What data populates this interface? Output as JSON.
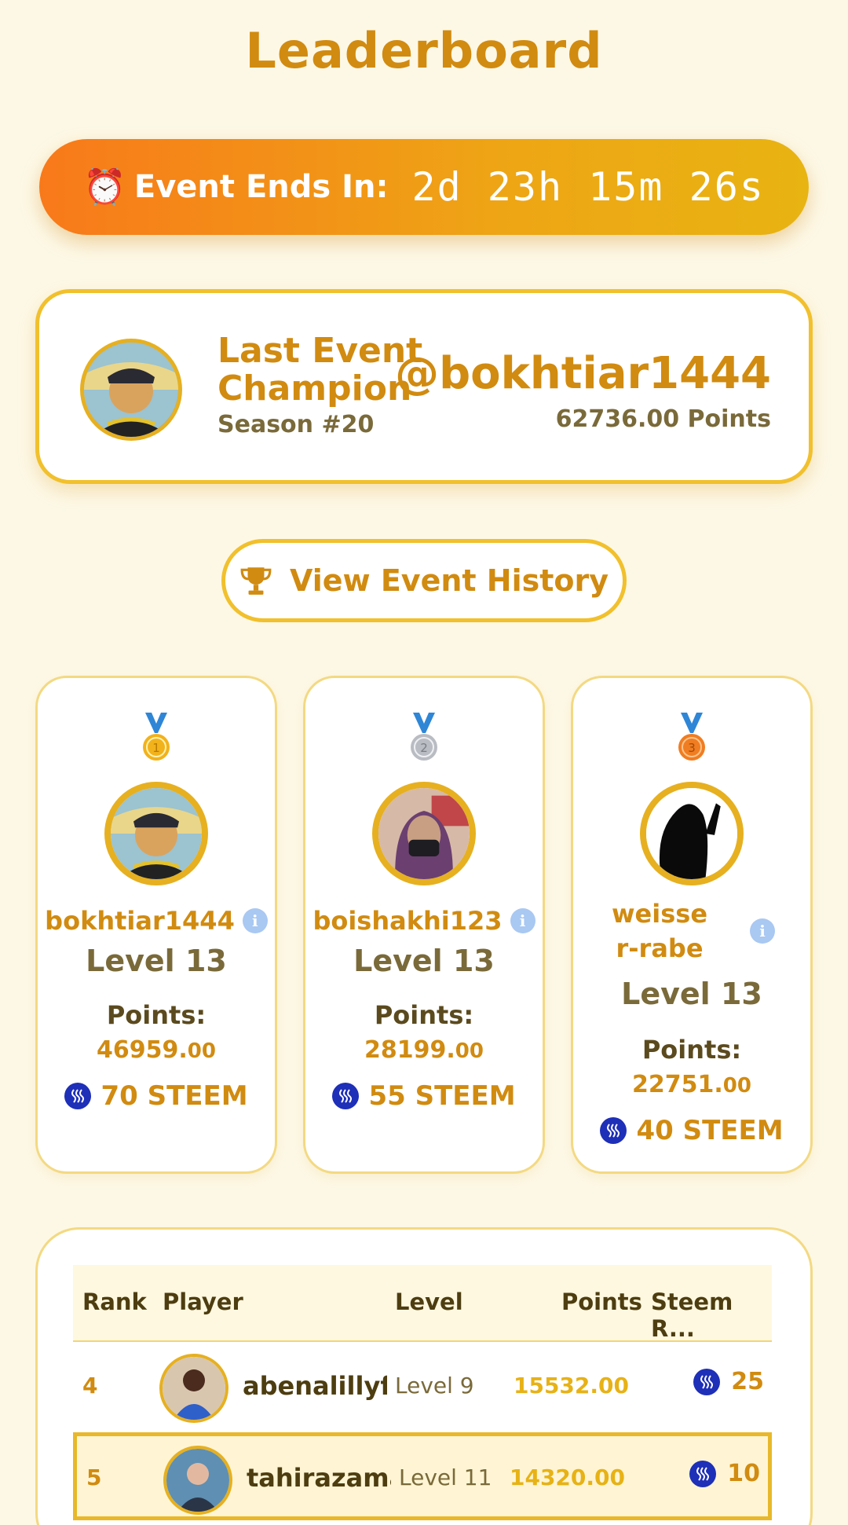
{
  "header": {
    "title": "Leaderboard"
  },
  "timer": {
    "label": "Event Ends In:",
    "value": "2d 23h 15m 26s",
    "icon": "alarm-clock-icon"
  },
  "champion": {
    "title": "Last Event Champion",
    "season": "Season #20",
    "username": "@bokhtiar1444",
    "points": "62736.00 Points"
  },
  "history_button": {
    "label": "View Event History",
    "icon": "trophy-icon"
  },
  "podium": [
    {
      "rank": "1",
      "name": "bokhtiar1444",
      "level": "Level 13",
      "points_label": "Points:",
      "points_main": "46959.",
      "points_dec": "00",
      "reward": "70 STEEM",
      "medal_color": "#f2b21b"
    },
    {
      "rank": "2",
      "name": "boishakhi123",
      "level": "Level 13",
      "points_label": "Points:",
      "points_main": "28199.",
      "points_dec": "00",
      "reward": "55 STEEM",
      "medal_color": "#b9bcc2"
    },
    {
      "rank": "3",
      "name": "weisser-rabe",
      "level": "Level 13",
      "points_label": "Points:",
      "points_main": "22751.",
      "points_dec": "00",
      "reward": "40 STEEM",
      "medal_color": "#f07d22"
    }
  ],
  "table": {
    "headers": {
      "rank": "Rank",
      "player": "Player",
      "level": "Level",
      "points": "Points",
      "reward": "Steem R..."
    },
    "rows": [
      {
        "rank": "4",
        "name": "abenalillyfl",
        "level": "Level 9",
        "points": "15532.00",
        "reward": "25"
      },
      {
        "rank": "5",
        "name": "tahirazama",
        "level": "Level 11",
        "points": "14320.00",
        "reward": "10"
      }
    ]
  },
  "colors": {
    "accent": "#d18b10",
    "gold": "#e6b020",
    "background": "#fdf8e6",
    "steem": "#1e2fb8"
  }
}
